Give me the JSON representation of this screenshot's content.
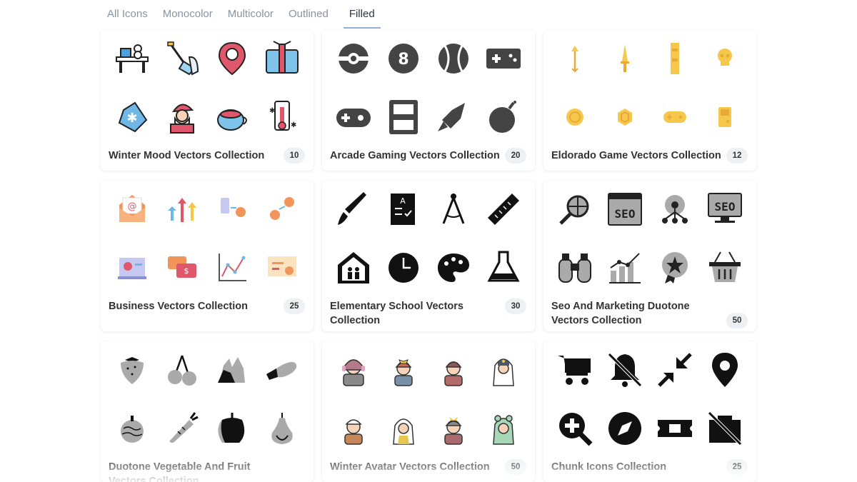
{
  "tabs": [
    {
      "label": "All Icons",
      "active": false
    },
    {
      "label": "Monocolor",
      "active": false
    },
    {
      "label": "Multicolor",
      "active": false
    },
    {
      "label": "Outlined",
      "active": false
    },
    {
      "label": "Filled",
      "active": true
    }
  ],
  "collections": [
    {
      "title": "Winter Mood Vectors Collection",
      "count": "10",
      "style": "multicolor"
    },
    {
      "title": "Arcade Gaming Vectors Collection",
      "count": "20",
      "style": "filled-dark"
    },
    {
      "title": "Eldorado Game Vectors Collection",
      "count": "12",
      "style": "gold"
    },
    {
      "title": "Business Vectors Collection",
      "count": "25",
      "style": "flat"
    },
    {
      "title": "Elementary School Vectors Collection",
      "count": "30",
      "style": "filled-black"
    },
    {
      "title": "Seo And Marketing Duotone Vectors Collection",
      "count": "50",
      "style": "duotone"
    },
    {
      "title": "Duotone Vegetable And Fruit Vectors Collection",
      "count": "",
      "style": "duotone-gray"
    },
    {
      "title": "Winter Avatar Vectors Collection",
      "count": "50",
      "style": "avatar"
    },
    {
      "title": "Chunk Icons Collection",
      "count": "25",
      "style": "filled-black"
    }
  ],
  "colors": {
    "accent": "#8fb3d9",
    "tab_inactive": "#8a93a3",
    "badge_bg": "#eef0f3"
  }
}
